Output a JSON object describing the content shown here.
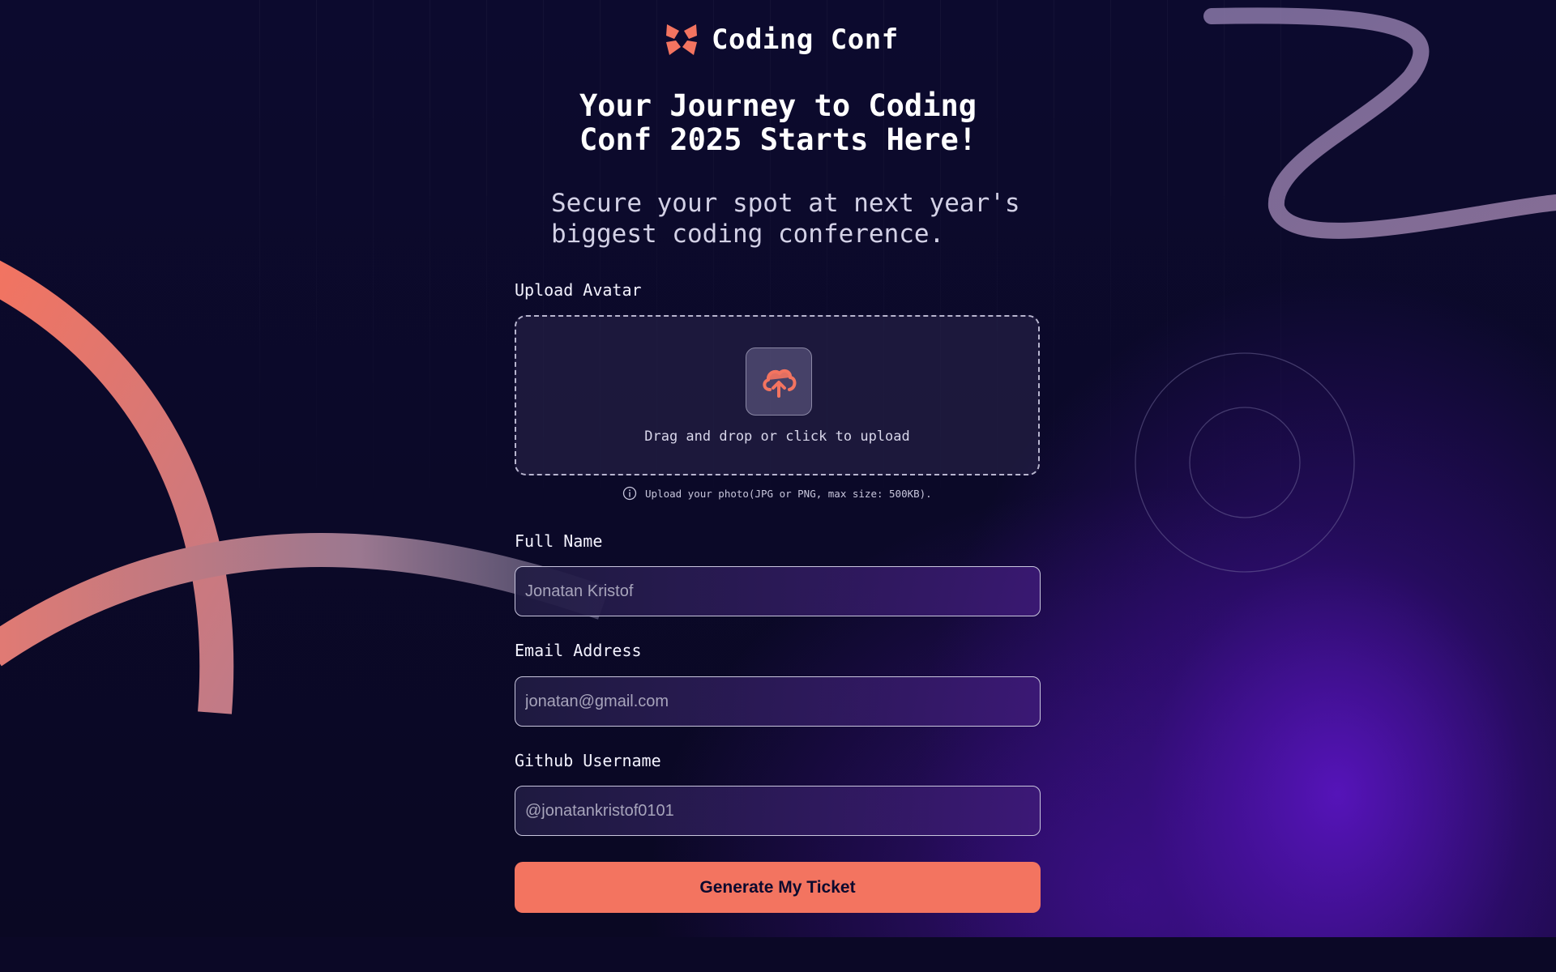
{
  "header": {
    "brand": "Coding Conf",
    "headline_line1": "Your Journey to Coding",
    "headline_line2": "Conf 2025 Starts Here!",
    "subtitle_line1": "Secure your spot at next year's",
    "subtitle_line2": "biggest coding conference."
  },
  "form": {
    "avatar_label": "Upload Avatar",
    "upload_text": "Drag and drop or click to upload",
    "upload_hint": "Upload your photo(JPG or PNG, max size: 500KB).",
    "fullname_label": "Full Name",
    "fullname_placeholder": "Jonatan Kristof",
    "email_label": "Email Address",
    "email_placeholder": "jonatan@gmail.com",
    "github_label": "Github Username",
    "github_placeholder": "@jonatankristof0101",
    "submit_label": "Generate My Ticket"
  },
  "colors": {
    "accent": "#f37460",
    "background": "#0b0826",
    "purple_glow": "#5814be"
  },
  "icons": {
    "logo": "coding-conf-logo-icon",
    "upload": "cloud-upload-icon",
    "info": "info-icon"
  }
}
